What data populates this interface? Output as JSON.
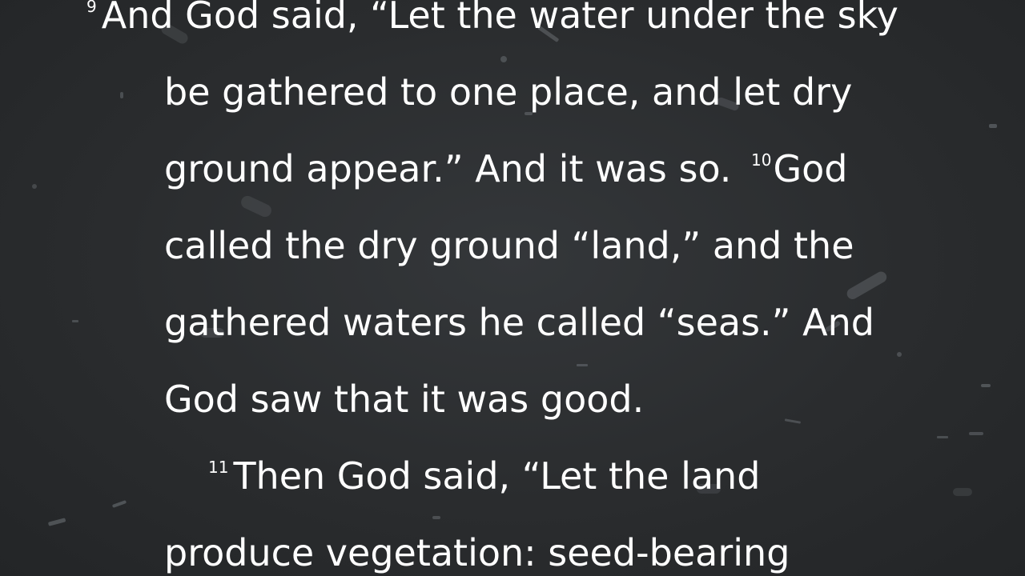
{
  "scripture": {
    "lines": [
      {
        "verse": "9",
        "text": "And God said, “Let the water under the sky"
      },
      {
        "text": "be gathered to one place, and let dry"
      },
      {
        "text": "ground appear.” And it was so.",
        "verse_mid": "10",
        "text_after": "God"
      },
      {
        "text": "called the dry ground “land,” and the"
      },
      {
        "text": "gathered waters he called “seas.” And"
      },
      {
        "text": "God saw that it was good."
      },
      {
        "verse": "11",
        "text": "Then God said, “Let the land"
      },
      {
        "text": "produce vegetation: seed-bearing"
      }
    ]
  }
}
